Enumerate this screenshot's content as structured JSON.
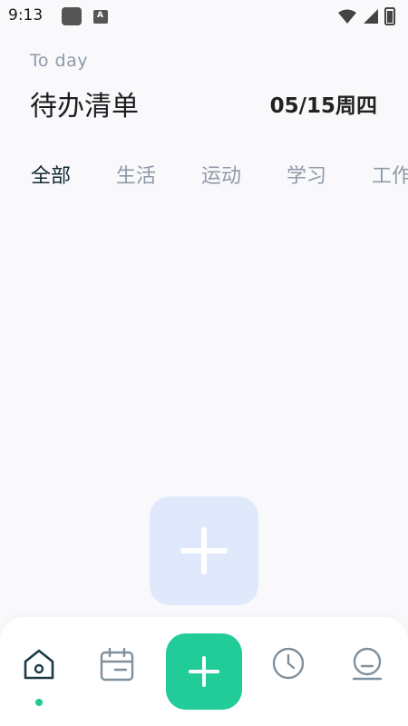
{
  "status_bar": {
    "time": "9:13"
  },
  "header": {
    "subtitle": "To day",
    "title": "待办清单",
    "date": "05/15周四"
  },
  "tabs": [
    {
      "label": "全部",
      "active": true
    },
    {
      "label": "生活",
      "active": false
    },
    {
      "label": "运动",
      "active": false
    },
    {
      "label": "学习",
      "active": false
    },
    {
      "label": "工作",
      "active": false
    }
  ],
  "bottom_nav": {
    "items": [
      "home-icon",
      "calendar-icon",
      "add-icon",
      "clock-icon",
      "profile-icon"
    ],
    "active": "home-icon"
  },
  "colors": {
    "accent": "#22cc98",
    "tab_active": "#102a33",
    "tab_inactive": "#8e9aa8",
    "ghost_button": "#e0e9fb",
    "nav_icon": "#7f909c",
    "nav_icon_active": "#1b3a45"
  }
}
